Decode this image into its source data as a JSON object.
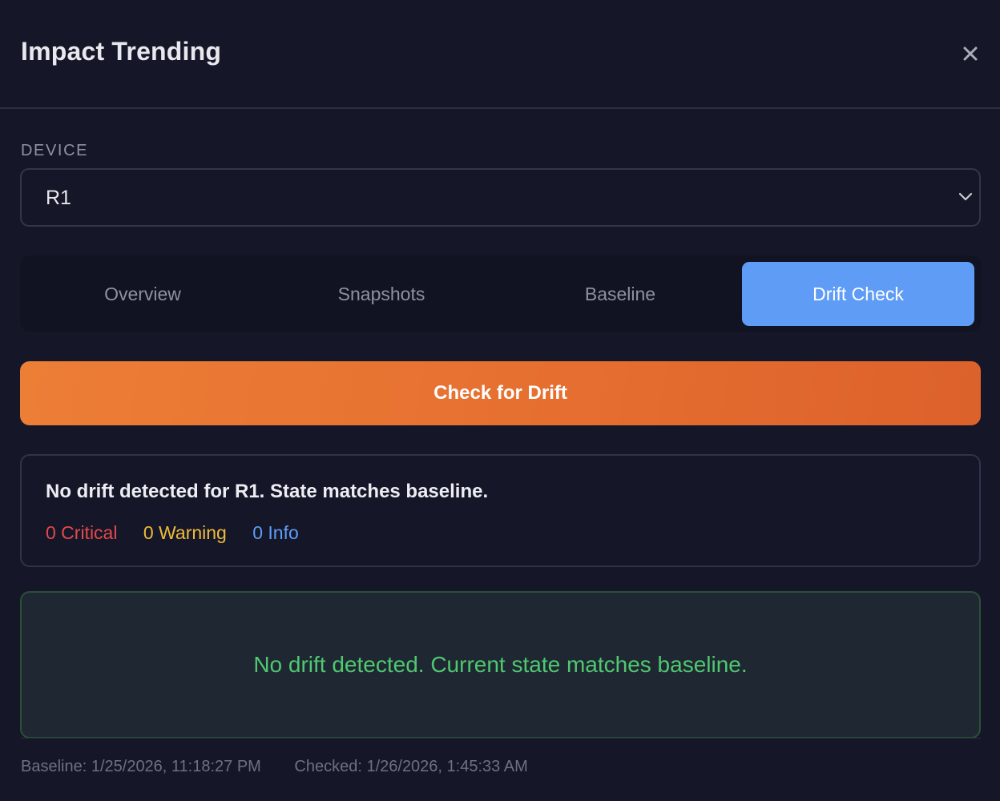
{
  "dialog": {
    "title": "Impact Trending"
  },
  "device": {
    "label": "DEVICE",
    "selected": "R1"
  },
  "tabs": [
    {
      "label": "Overview",
      "active": false
    },
    {
      "label": "Snapshots",
      "active": false
    },
    {
      "label": "Baseline",
      "active": false
    },
    {
      "label": "Drift Check",
      "active": true
    }
  ],
  "actions": {
    "check_drift_label": "Check for Drift"
  },
  "summary": {
    "message": "No drift detected for R1. State matches baseline.",
    "critical": "0 Critical",
    "warning": "0 Warning",
    "info": "0 Info"
  },
  "result": {
    "message": "No drift detected. Current state matches baseline."
  },
  "footer": {
    "baseline": "Baseline: 1/25/2026, 11:18:27 PM",
    "checked": "Checked: 1/26/2026, 1:45:33 AM"
  },
  "colors": {
    "background": "#151728",
    "accent_blue": "#5f9cf6",
    "accent_orange": "#e66f30",
    "critical": "#e5484d",
    "warning": "#efba3c",
    "success": "#4fc870"
  },
  "icons": {
    "close": "close-icon",
    "select": "chevron-down-icon"
  }
}
